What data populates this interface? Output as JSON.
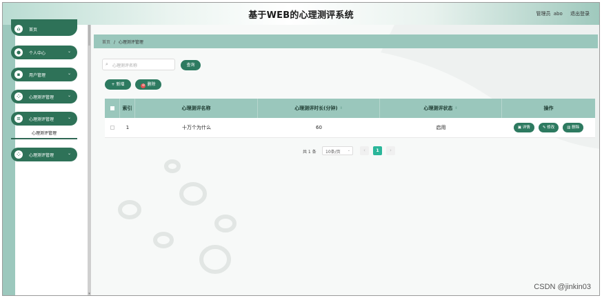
{
  "header": {
    "title": "基于WEB的心理测评系统",
    "role": "管理员",
    "username": "abo",
    "logout": "退出登录"
  },
  "sidebar": {
    "items": [
      {
        "label": "首页",
        "icon": "home-icon"
      },
      {
        "label": "个人中心",
        "icon": "person-icon"
      },
      {
        "label": "用户管理",
        "icon": "user-icon"
      },
      {
        "label": "心理测评管理",
        "icon": "grid-icon"
      },
      {
        "label": "心理测评管理",
        "icon": "list-icon"
      },
      {
        "label": "心理测评管理",
        "icon": "grid-icon"
      }
    ],
    "sub_item": "心理测评管理"
  },
  "breadcrumb": {
    "home": "首页",
    "separator": "/",
    "current": "心理测评管理"
  },
  "search": {
    "placeholder": "心理测评名称",
    "button": "查询"
  },
  "toolbar": {
    "add": "+ 新增",
    "delete": "删除"
  },
  "table": {
    "columns": [
      "索引",
      "心理测评名称",
      "心理测评时长(分钟)",
      "心理测评状态",
      "操作"
    ],
    "rows": [
      {
        "index": "1",
        "name": "十万个为什么",
        "duration": "60",
        "status": "启用"
      }
    ],
    "actions": {
      "detail": "详情",
      "edit": "修改",
      "delete": "删除"
    }
  },
  "pagination": {
    "total": "共 1 条",
    "page_size": "10条/页",
    "current_page": "1"
  },
  "watermark_text": "CSDN @jinkin03",
  "colors": {
    "primary": "#2d7a60",
    "header_row": "#9ac7bc",
    "active_page": "#2bb69a",
    "danger": "#e05252"
  }
}
